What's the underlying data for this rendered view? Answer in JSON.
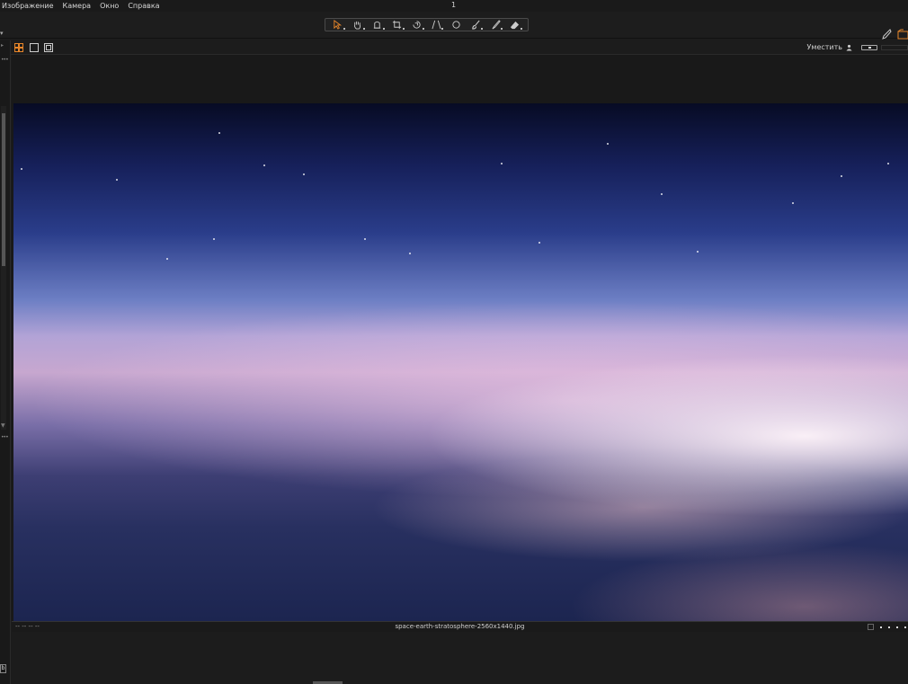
{
  "menu": {
    "items": [
      "Изображение",
      "Камера",
      "Окно",
      "Справка"
    ],
    "window_number": "1"
  },
  "toolbar": {
    "tools": [
      "select-tool",
      "hand-tool",
      "straighten-tool",
      "crop-tool",
      "rotate-tool",
      "keystone-tool",
      "spot-tool",
      "brush-tool",
      "gradient-tool",
      "eraser-tool"
    ],
    "accent": "#e8862a"
  },
  "viewbar": {
    "fit_label": "Уместить"
  },
  "status": {
    "left": "-- -- -- --",
    "filename": "space-earth-stratosphere-2560x1440.jpg"
  },
  "leftstrip": {
    "bottom_label": "b"
  }
}
